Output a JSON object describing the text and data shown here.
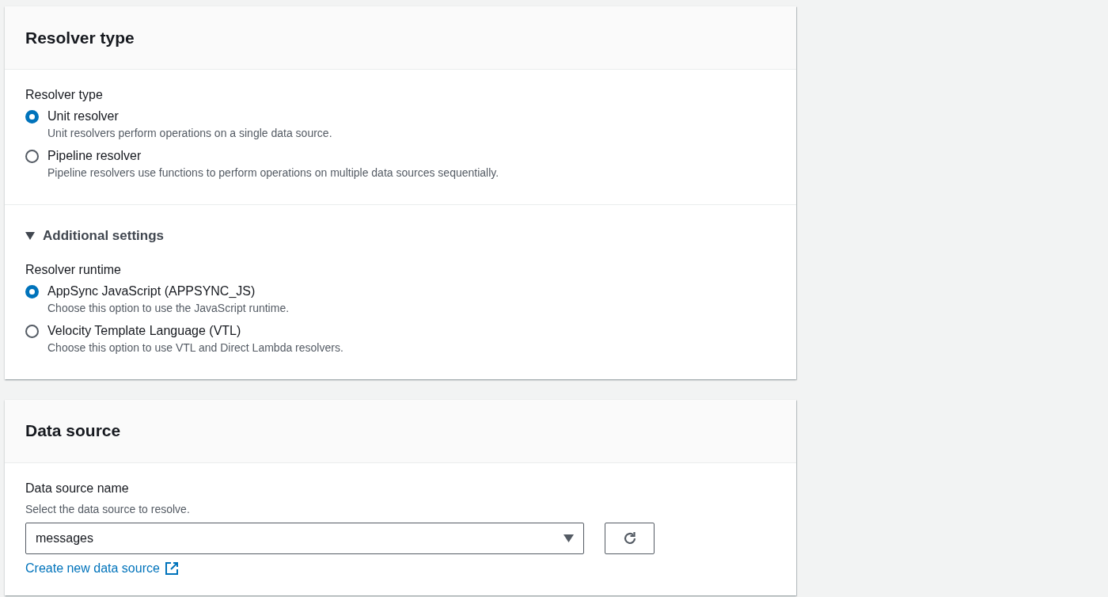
{
  "panels": [
    {
      "title": "Resolver type",
      "sections": [
        {
          "kind": "radios",
          "label": "Resolver type",
          "options": [
            {
              "label": "Unit resolver",
              "description": "Unit resolvers perform operations on a single data source.",
              "selected": true
            },
            {
              "label": "Pipeline resolver",
              "description": "Pipeline resolvers use functions to perform operations on multiple data sources sequentially.",
              "selected": false
            }
          ]
        },
        {
          "kind": "expander",
          "label": "Additional settings",
          "expanded": true,
          "field": {
            "label": "Resolver runtime",
            "options": [
              {
                "label": "AppSync JavaScript (APPSYNC_JS)",
                "description": "Choose this option to use the JavaScript runtime.",
                "selected": true
              },
              {
                "label": "Velocity Template Language (VTL)",
                "description": "Choose this option to use VTL and Direct Lambda resolvers.",
                "selected": false
              }
            ]
          }
        }
      ]
    },
    {
      "title": "Data source",
      "sections": [
        {
          "kind": "select",
          "label": "Data source name",
          "description": "Select the data source to resolve.",
          "value": "messages",
          "link": "Create new data source"
        }
      ]
    }
  ]
}
